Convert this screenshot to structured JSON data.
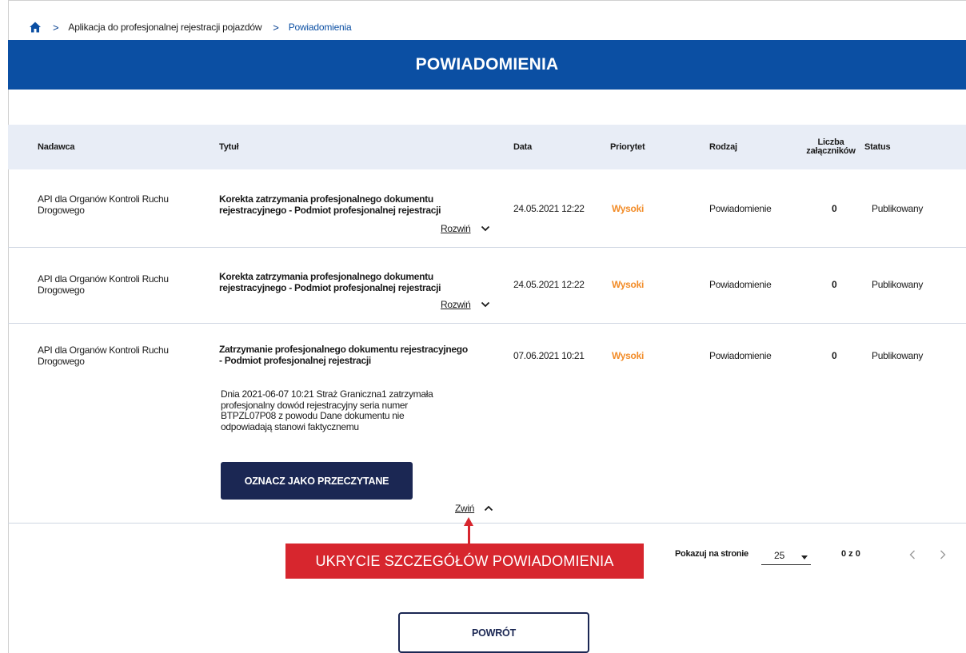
{
  "breadcrumb": {
    "items": [
      "Aplikacja do profesjonalnej rejestracji pojazdów",
      "Powiadomienia"
    ]
  },
  "page_title": "POWIADOMIENIA",
  "table": {
    "headers": {
      "sender": "Nadawca",
      "title": "Tytuł",
      "date": "Data",
      "priority": "Priorytet",
      "kind": "Rodzaj",
      "attachments_line1": "Liczba",
      "attachments_line2": "załączników",
      "status": "Status"
    },
    "rows": [
      {
        "sender_l1": "API dla Organów Kontroli Ruchu",
        "sender_l2": "Drogowego",
        "title_l1": "Korekta zatrzymania profesjonalnego dokumentu",
        "title_l2": "rejestracyjnego - Podmiot profesjonalnej rejestracji",
        "date": "24.05.2021 12:22",
        "priority": "Wysoki",
        "kind": "Powiadomienie",
        "attachments": "0",
        "status": "Publikowany",
        "toggle": "Rozwiń"
      },
      {
        "sender_l1": "API dla Organów Kontroli Ruchu",
        "sender_l2": "Drogowego",
        "title_l1": "Korekta zatrzymania profesjonalnego dokumentu",
        "title_l2": "rejestracyjnego - Podmiot profesjonalnej rejestracji",
        "date": "24.05.2021 12:22",
        "priority": "Wysoki",
        "kind": "Powiadomienie",
        "attachments": "0",
        "status": "Publikowany",
        "toggle": "Rozwiń"
      },
      {
        "sender_l1": "API dla Organów Kontroli Ruchu",
        "sender_l2": "Drogowego",
        "title_l1": "Zatrzymanie profesjonalnego dokumentu rejestracyjnego",
        "title_l2": "- Podmiot profesjonalnej rejestracji",
        "date": "07.06.2021 10:21",
        "priority": "Wysoki",
        "kind": "Powiadomienie",
        "attachments": "0",
        "status": "Publikowany",
        "description_lines": [
          "Dnia 2021-06-07 10:21 Straż Graniczna1 zatrzymała",
          "profesjonalny dowód rejestracyjny seria numer",
          "BTPZL07P08 z powodu Dane dokumentu nie",
          "odpowiadają stanowi faktycznemu"
        ],
        "mark_read": "OZNACZ JAKO PRZECZYTANE",
        "toggle": "Zwiń"
      }
    ]
  },
  "annotation": "UKRYCIE SZCZEGÓŁÓW POWIADOMIENIA",
  "pagination": {
    "per_page_label": "Pokazuj na stronie",
    "per_page_value": "25",
    "range": "0 z 0"
  },
  "back_button": "POWRÓT",
  "colors": {
    "banner": "#0b4fa3",
    "header_bg": "#e8edf6",
    "priority_high": "#f28c28",
    "primary_dark": "#1b2753",
    "annotation_red": "#d7262e"
  },
  "icons": [
    "home-icon",
    "chevron-right-icon",
    "chevron-down-icon",
    "chevron-up-icon",
    "caret-down-icon",
    "chevron-left-icon"
  ]
}
